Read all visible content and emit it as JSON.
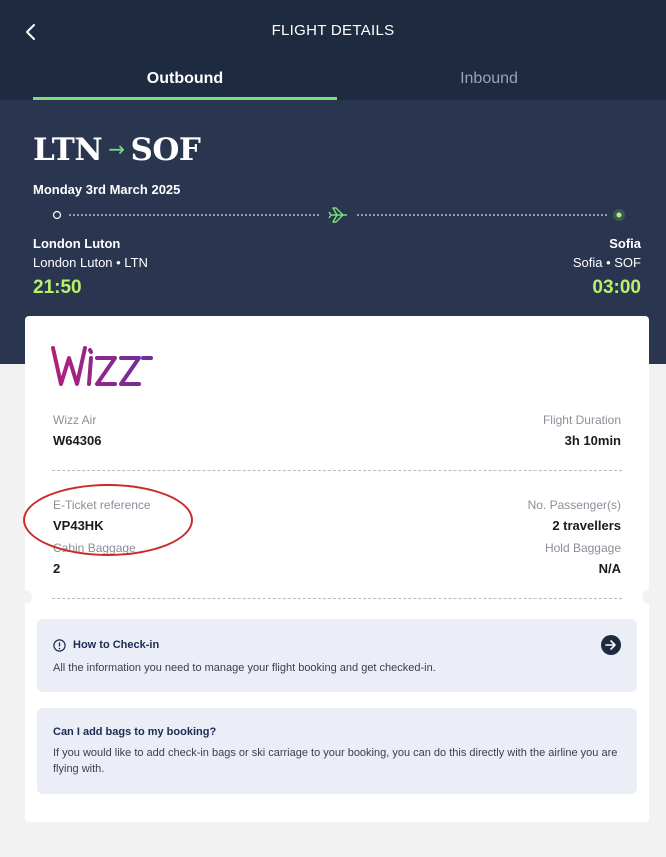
{
  "header": {
    "title": "FLIGHT DETAILS",
    "back_icon": "chevron-left-icon"
  },
  "tabs": [
    {
      "label": "Outbound",
      "active": true
    },
    {
      "label": "Inbound",
      "active": false
    }
  ],
  "flight": {
    "origin_code": "LTN",
    "dest_code": "SOF",
    "arrow": "→",
    "date": "Monday 3rd March 2025",
    "origin_city": "London Luton",
    "origin_airport": "London Luton • LTN",
    "dest_city": "Sofia",
    "dest_airport": "Sofia • SOF",
    "depart_time": "21:50",
    "arrive_time": "03:00",
    "plane_icon": "airplane-icon"
  },
  "details": {
    "airline_label": "Wizz Air",
    "flight_number": "W64306",
    "duration_label": "Flight Duration",
    "duration": "3h 10min",
    "eticket_label": "E-Ticket reference",
    "eticket": "VP43HK",
    "passengers_label": "No. Passenger(s)",
    "passengers": "2 travellers",
    "cabin_label": "Cabin Baggage",
    "cabin": "2",
    "hold_label": "Hold Baggage",
    "hold": "N/A"
  },
  "checkin": {
    "title": "How to Check-in",
    "text": "All the information you need to manage your flight booking and get checked-in."
  },
  "bags": {
    "title": "Can I add bags to my booking?",
    "text": "If you would like to add check-in bags or ski carriage to your booking, you can do this directly with the airline you are flying with."
  },
  "logo": {
    "text": "Wizz"
  },
  "colors": {
    "navy": "#1e2a40",
    "hero": "#2a3650",
    "accent_green": "#7be07b",
    "time_green": "#b8f06a",
    "wizz_purple": "#a3298f"
  }
}
